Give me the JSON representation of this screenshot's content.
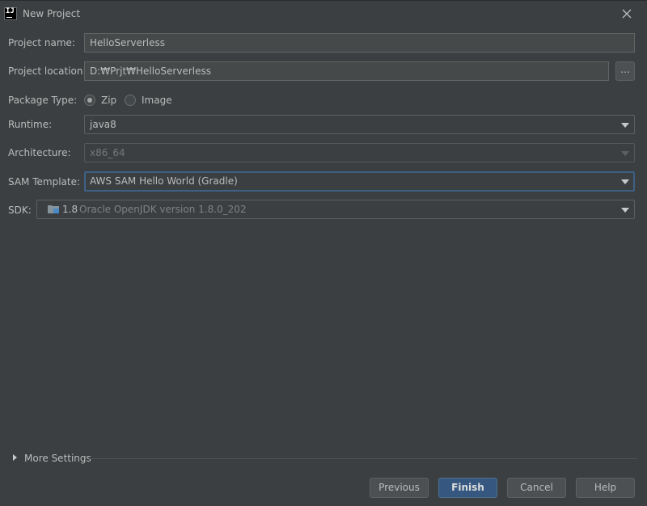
{
  "window": {
    "title": "New Project",
    "app_icon_text": "IJ"
  },
  "form": {
    "project_name": {
      "label": "Project name:",
      "value": "HelloServerless"
    },
    "project_location": {
      "label": "Project location:",
      "value": "D:₩Prjt₩HelloServerless",
      "browse_label": "..."
    },
    "package_type": {
      "label": "Package Type:",
      "options": [
        {
          "label": "Zip",
          "selected": true
        },
        {
          "label": "Image",
          "selected": false
        }
      ]
    },
    "runtime": {
      "label": "Runtime:",
      "value": "java8"
    },
    "architecture": {
      "label": "Architecture:",
      "value": "x86_64",
      "disabled": true
    },
    "sam_template": {
      "label": "SAM Template:",
      "value": "AWS SAM Hello World (Gradle)"
    },
    "sdk": {
      "label": "SDK:",
      "version": "1.8",
      "description": "Oracle OpenJDK version 1.8.0_202",
      "icon": "folder-icon"
    }
  },
  "more_settings": {
    "label": "More Settings"
  },
  "buttons": {
    "previous": "Previous",
    "finish": "Finish",
    "cancel": "Cancel",
    "help": "Help"
  },
  "colors": {
    "background": "#3c3f41",
    "field_background": "#45494a",
    "primary_button": "#365880",
    "focus_border": "#3d6185"
  }
}
